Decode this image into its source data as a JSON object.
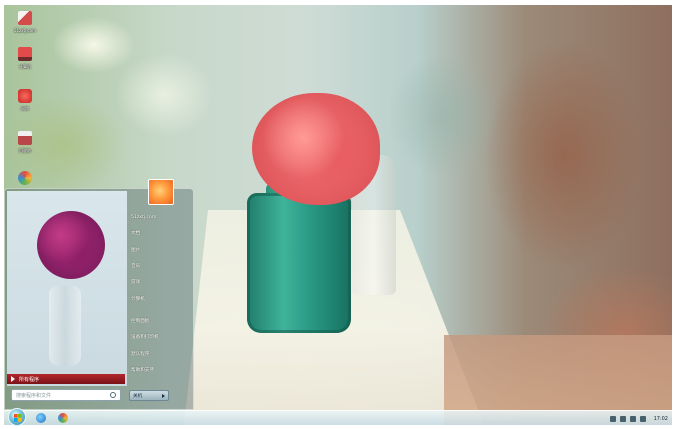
{
  "window": {
    "title": ""
  },
  "desktop_icons": [
    {
      "label": "51zxtj.com",
      "icon": "book-icon",
      "color": "#d44b4b"
    },
    {
      "label": "计算机",
      "icon": "computer-icon",
      "color": "#c73a3a"
    },
    {
      "label": "网络",
      "icon": "network-icon",
      "color": "#e0443a"
    },
    {
      "label": "回收站",
      "icon": "recycle-bin-icon",
      "color": "#b84848"
    },
    {
      "label": "",
      "icon": "media-player-icon",
      "color": "#e86d2e"
    }
  ],
  "start_menu": {
    "all_programs_label": "所有程序",
    "search_placeholder": "搜索程序和文件",
    "shutdown_label": "关机",
    "right_items": [
      "51zxtj.com",
      "文档",
      "图片",
      "音乐",
      "游戏",
      "计算机",
      "控制面板",
      "设备和打印机",
      "默认程序",
      "帮助和支持"
    ]
  },
  "taskbar": {
    "clock": "17:02",
    "pinned": [
      {
        "icon": "internet-explorer-icon"
      },
      {
        "icon": "media-player-icon"
      }
    ],
    "tray_icons": [
      "language-icon",
      "network-tray-icon",
      "volume-icon",
      "flag-icon"
    ]
  },
  "colors": {
    "accent_red": "#b3262c",
    "flower_pink": "#f27477",
    "jar_green": "#2a9a84"
  }
}
